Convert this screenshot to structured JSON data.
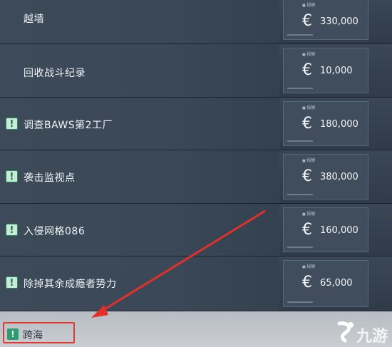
{
  "missions": [
    {
      "title": "越墙",
      "has_alert": false,
      "reward_label": "报酬",
      "currency": "€",
      "amount": "330,000"
    },
    {
      "title": "回收战斗纪录",
      "has_alert": false,
      "reward_label": "报酬",
      "currency": "€",
      "amount": "10,000"
    },
    {
      "title": "调查BAWS第2工厂",
      "has_alert": true,
      "reward_label": "报酬",
      "currency": "€",
      "amount": "180,000"
    },
    {
      "title": "袭击监视点",
      "has_alert": true,
      "reward_label": "报酬",
      "currency": "€",
      "amount": "380,000"
    },
    {
      "title": "入侵网格086",
      "has_alert": true,
      "reward_label": "报酬",
      "currency": "€",
      "amount": "160,000"
    },
    {
      "title": "除掉其余成瘾者势力",
      "has_alert": true,
      "reward_label": "报酬",
      "currency": "€",
      "amount": "65,000"
    }
  ],
  "selected_mission": {
    "title": "跨海",
    "has_alert": true
  },
  "alert_glyph": "!",
  "watermark": {
    "text": "九游"
  },
  "colors": {
    "accent_alert": "#2c9d73",
    "highlight": "#e23a2f",
    "panel": "#3a4857"
  }
}
